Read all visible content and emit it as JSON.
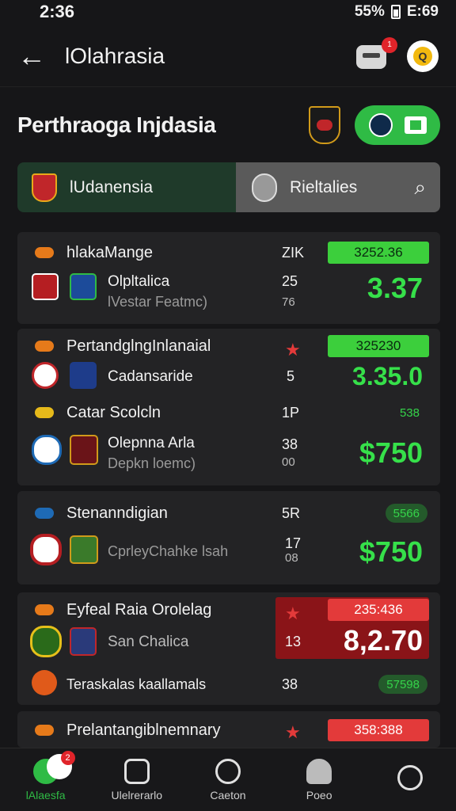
{
  "status": {
    "time": "2:36",
    "battery": "55%",
    "signal_text": "E:69"
  },
  "header": {
    "title": "lOlahrasia",
    "notif_count": "1"
  },
  "section": {
    "title": "Perthraoga Injdasia"
  },
  "tabs": {
    "left": "lUdanensia",
    "right": "Rieltalies"
  },
  "cards": [
    {
      "title": "hlakaMange",
      "code": "ZIK",
      "odd": "3252.36",
      "match_label": "Olpltalica",
      "match_sub": "lVestar Featmc)",
      "num1": "25",
      "num2": "76",
      "big": "3.37"
    },
    {
      "title": "PertandglngInlanaial",
      "odd": "325230",
      "match_label": "Cadansaride",
      "num1": "5",
      "big": "3.35.0",
      "row3_label": "Catar Scolcln",
      "row3_code": "1P",
      "row3_odd": "538",
      "row4_label": "Olepnna Arla",
      "row4_sub": "Depkn loemc)",
      "row4_num1": "38",
      "row4_num2": "00",
      "row4_big": "$750"
    },
    {
      "title": "Stenanndigian",
      "code": "5R",
      "odd": "5566",
      "match_label": "CprleyChahke lsah",
      "num1": "17",
      "num2": "08",
      "big": "$750"
    },
    {
      "title": "Eyfeal Raia Orolelag",
      "odd": "235:436",
      "match_label": "San Chalica",
      "num1": "13",
      "big": "8,2.70",
      "row3_label": "Teraskalas kaallamals",
      "row3_code": "38",
      "row3_odd": "57598"
    },
    {
      "title": "Prelantangiblnemnary",
      "odd": "358:388"
    }
  ],
  "nav": [
    {
      "label": "lAlaesfa",
      "badge": "2"
    },
    {
      "label": "Ulelrerarlo"
    },
    {
      "label": "Caeton"
    },
    {
      "label": "Poeo"
    },
    {
      "label": ""
    }
  ],
  "colors": {
    "accent": "#2fbb45",
    "alert": "#e33a3a",
    "bg": "#161618"
  }
}
